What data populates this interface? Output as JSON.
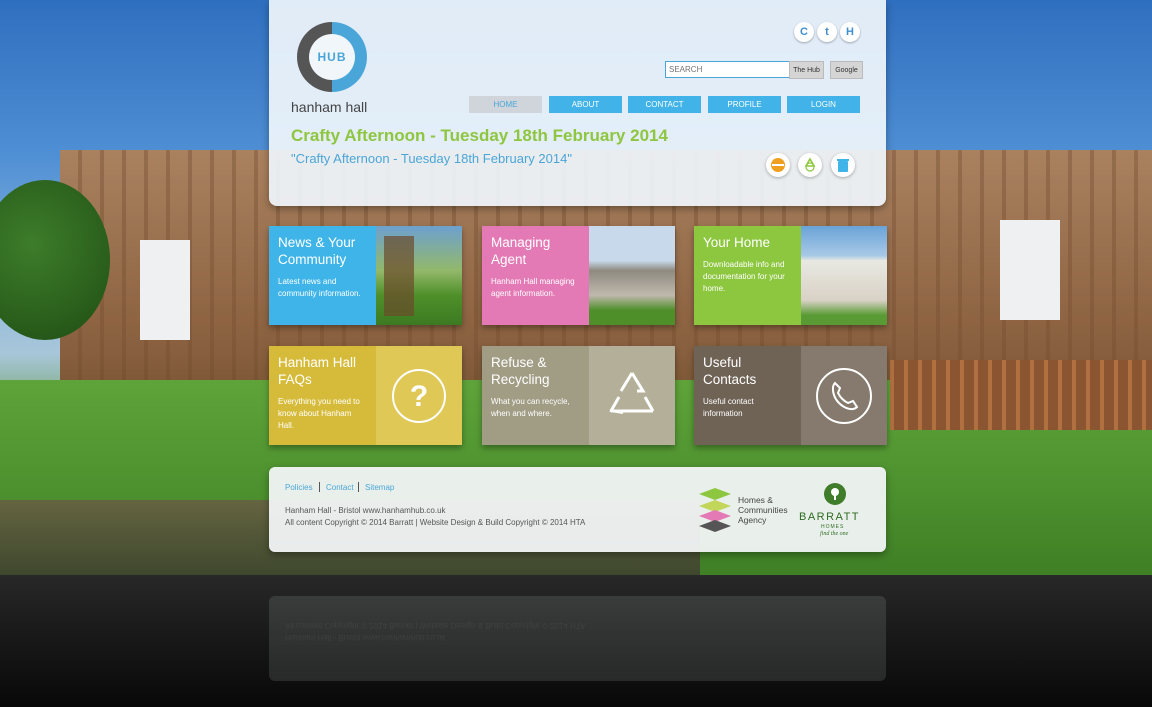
{
  "site": {
    "logo_badge": "HUB",
    "logo_name": "hanham hall"
  },
  "social": [
    {
      "name": "refresh-icon",
      "glyph": "C"
    },
    {
      "name": "twitter-icon",
      "glyph": "t"
    },
    {
      "name": "hub-icon",
      "glyph": "H"
    }
  ],
  "search": {
    "placeholder": "SEARCH",
    "hub_button": "The Hub",
    "google_button": "Google"
  },
  "nav": {
    "home": "HOME",
    "about": "ABOUT",
    "contact": "CONTACT",
    "profile": "PROFILE",
    "login": "LOGIN"
  },
  "page": {
    "heading": "Crafty Afternoon - Tuesday 18th February 2014",
    "subheading": "\"Crafty Afternoon - Tuesday 18th February 2014\""
  },
  "tiles": [
    {
      "title": "News & Your Community",
      "desc": "Latest news and community information.",
      "color": "#3eb4e8"
    },
    {
      "title": "Managing Agent",
      "desc": "Hanham Hall managing agent information.",
      "color": "#e47ab5"
    },
    {
      "title": "Your Home",
      "desc": "Downloadable info and documentation for your home.",
      "color": "#8dc63f"
    },
    {
      "title": "Hanham Hall FAQs",
      "desc": "Everything you need to know about Hanham Hall.",
      "color": "#d6bb3a",
      "icon": "question-icon"
    },
    {
      "title": "Refuse & Recycling",
      "desc": "What you can recycle, when and where.",
      "color": "#a19d85",
      "icon": "recycle-icon"
    },
    {
      "title": "Useful Contacts",
      "desc": "Useful contact information",
      "color": "#6f6356",
      "icon": "phone-icon"
    }
  ],
  "footer": {
    "links": [
      "Policies",
      "Contact",
      "Sitemap"
    ],
    "address": "Hanham Hall - Bristol  www.hanhamhub.co.uk",
    "copyright": "All content Copyright © 2014 Barratt  |  Website Design & Build Copyright © 2014 HTA",
    "hca_text": "Homes & Communities Agency",
    "barratt_name": "BARRATT",
    "barratt_sub": "HOMES",
    "barratt_tag": "find the one"
  }
}
